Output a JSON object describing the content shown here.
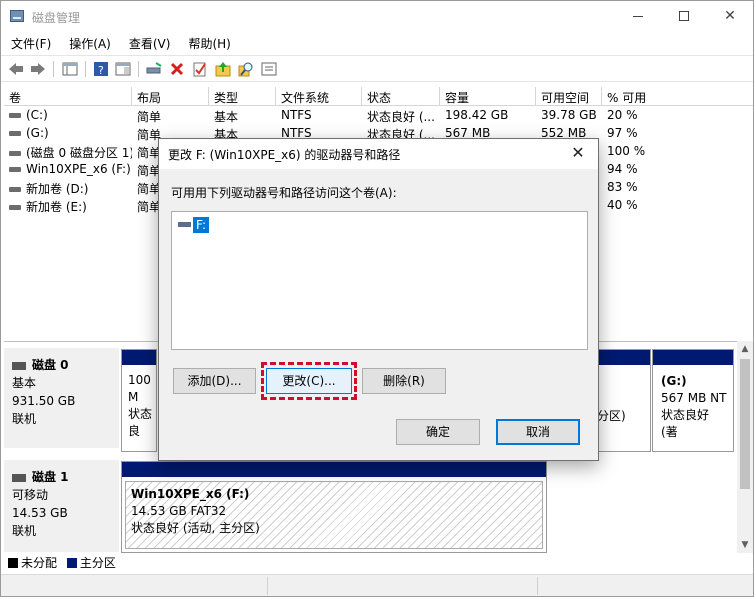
{
  "window": {
    "title": "磁盘管理"
  },
  "menu": [
    "文件(F)",
    "操作(A)",
    "查看(V)",
    "帮助(H)"
  ],
  "columns": [
    "卷",
    "布局",
    "类型",
    "文件系统",
    "状态",
    "容量",
    "可用空间",
    "% 可用"
  ],
  "volumes": [
    {
      "name": "(C:)",
      "layout": "简单",
      "type": "基本",
      "fs": "NTFS",
      "status": "状态良好 (...",
      "capacity": "198.42 GB",
      "free": "39.78 GB",
      "pct": "20 %"
    },
    {
      "name": "(G:)",
      "layout": "简单",
      "type": "基本",
      "fs": "NTFS",
      "status": "状态良好 (...",
      "capacity": "567 MB",
      "free": "552 MB",
      "pct": "97 %"
    },
    {
      "name": "(磁盘 0 磁盘分区 1)",
      "layout": "简单",
      "type": "",
      "fs": "",
      "status": "",
      "capacity": "",
      "free": "",
      "pct": "100 %"
    },
    {
      "name": "Win10XPE_x6 (F:)",
      "layout": "简单",
      "type": "",
      "fs": "",
      "status": "",
      "capacity": "",
      "free": "",
      "pct": "94 %"
    },
    {
      "name": "新加卷 (D:)",
      "layout": "简单",
      "type": "",
      "fs": "",
      "status": "",
      "capacity": "",
      "free": "",
      "pct": "83 %"
    },
    {
      "name": "新加卷 (E:)",
      "layout": "简单",
      "type": "",
      "fs": "",
      "status": "",
      "capacity": "",
      "free": "",
      "pct": "40 %"
    }
  ],
  "disks": {
    "disk0": {
      "name": "磁盘 0",
      "type": "基本",
      "size": "931.50 GB",
      "state": "联机",
      "part_left_line1": "100 M",
      "part_left_line2": "状态良",
      "part_mid_text": "分区)",
      "part_g_title": "(G:)",
      "part_g_size": "567 MB NT",
      "part_g_status": "状态良好 (著"
    },
    "disk1": {
      "name": "磁盘 1",
      "type": "可移动",
      "size": "14.53 GB",
      "state": "联机",
      "part_title": "Win10XPE_x6  (F:)",
      "part_size": "14.53 GB FAT32",
      "part_status": "状态良好 (活动, 主分区)"
    }
  },
  "legend": {
    "unallocated": "未分配",
    "primary": "主分区"
  },
  "dialog": {
    "title": "更改 F: (Win10XPE_x6) 的驱动器号和路径",
    "label": "可用用下列驱动器号和路径访问这个卷(A):",
    "list_item": "F:",
    "add": "添加(D)...",
    "change": "更改(C)...",
    "delete": "删除(R)",
    "ok": "确定",
    "cancel": "取消"
  },
  "colors": {
    "accent": "#0078d7",
    "primary_partition": "#001a72",
    "highlight": "#d0102a"
  }
}
